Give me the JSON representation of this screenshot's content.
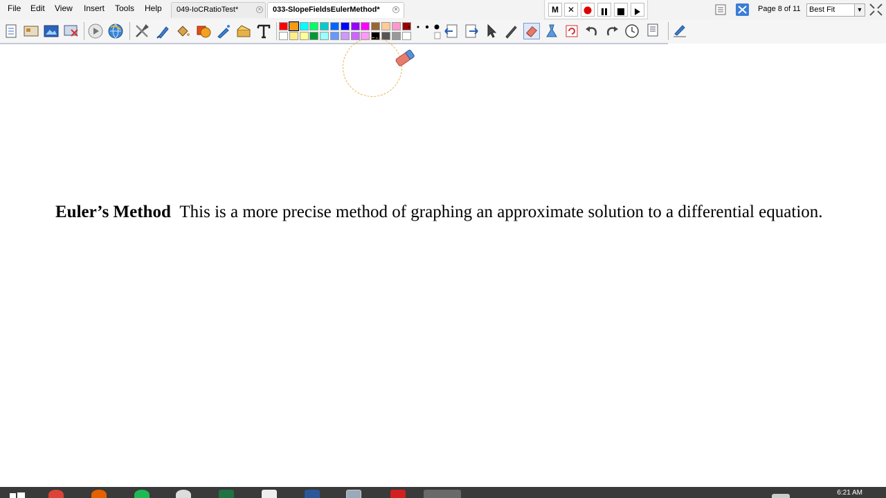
{
  "menu": [
    "File",
    "Edit",
    "View",
    "Insert",
    "Tools",
    "Help"
  ],
  "tabs": [
    {
      "label": "049-IoCRatioTest*",
      "active": false
    },
    {
      "label": "033-SlopeFieldsEulerMethod*",
      "active": true
    }
  ],
  "recording": {
    "m_label": "M",
    "x_label": "✕"
  },
  "page_indicator": "Page 8 of 11",
  "zoom": {
    "value": "Best Fit"
  },
  "palette": {
    "top_row": [
      "#ff0000",
      "#ff9900",
      "#00ffff",
      "#00ff66",
      "#00cccc",
      "#0066ff",
      "#0000ff",
      "#9900ff",
      "#ff00ff",
      "#996633",
      "#ffcc99",
      "#ff99cc",
      "#990000"
    ],
    "bottom_row": [
      "#ffffff",
      "#ffee88",
      "#ffff99",
      "#009933",
      "#99ffff",
      "#6699ff",
      "#cc99ff",
      "#cc66ff",
      "#ff99ff",
      "#000000",
      "#555555",
      "#999999",
      "#ffffff"
    ]
  },
  "toolbar_icons": [
    "new-page-icon",
    "insert-image-icon",
    "insert-picture-icon",
    "screen-capture-icon",
    "play-icon",
    "web-browser-icon",
    "tools-icon",
    "highlighter-icon",
    "fill-bucket-icon",
    "shape-icon",
    "pen-icon",
    "stamp-icon",
    "text-tool-icon",
    "pen-size-icon",
    "prev-page-icon",
    "next-page-icon",
    "select-arrow-icon",
    "pencil-icon",
    "eraser-tool-icon",
    "clear-icon",
    "refresh-icon",
    "undo-icon",
    "redo-icon",
    "timer-icon",
    "notes-icon",
    "signature-icon"
  ],
  "content": {
    "heading": "Euler’s Method",
    "body": "This is a more precise method of graphing an approximate solution to a differential equation."
  },
  "taskbar": {
    "clock": "6:21 AM"
  },
  "colors": {
    "menubar": "#f3f3f3",
    "toolbar": "#f5f5f5",
    "eraser_ring": "#e8b14a",
    "record_red": "#e00000"
  }
}
